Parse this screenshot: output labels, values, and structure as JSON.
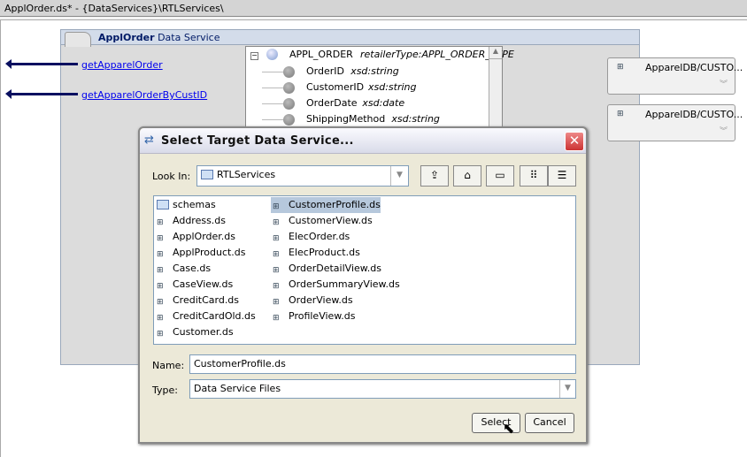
{
  "window": {
    "title": "ApplOrder.ds* - {DataServices}\\RTLServices\\"
  },
  "data_service": {
    "name": "ApplOrder",
    "kind": "Data Service",
    "operations": [
      "getApparelOrder",
      "getApparelOrderByCustID"
    ],
    "tree": {
      "root": {
        "name": "APPL_ORDER",
        "type": "retailerType:APPL_ORDER_TYPE"
      },
      "children": [
        {
          "name": "OrderID",
          "type": "xsd:string"
        },
        {
          "name": "CustomerID",
          "type": "xsd:string"
        },
        {
          "name": "OrderDate",
          "type": "xsd:date"
        },
        {
          "name": "ShippingMethod",
          "type": "xsd:string"
        }
      ]
    }
  },
  "sources": [
    "ApparelDB/CUSTO...",
    "ApparelDB/CUSTO..."
  ],
  "dialog": {
    "title": "Select Target Data Service...",
    "look_in_label": "Look In:",
    "look_in_value": "RTLServices",
    "files": [
      "schemas",
      "Address.ds",
      "ApplOrder.ds",
      "ApplProduct.ds",
      "Case.ds",
      "CaseView.ds",
      "CreditCard.ds",
      "CreditCardOld.ds",
      "Customer.ds",
      "CustomerProfile.ds",
      "CustomerView.ds",
      "ElecOrder.ds",
      "ElecProduct.ds",
      "OrderDetailView.ds",
      "OrderSummaryView.ds",
      "OrderView.ds",
      "ProfileView.ds"
    ],
    "selected_file": "CustomerProfile.ds",
    "name_label": "Name:",
    "name_value": "CustomerProfile.ds",
    "type_label": "Type:",
    "type_value": "Data Service Files",
    "select_label": "Select",
    "cancel_label": "Cancel"
  }
}
